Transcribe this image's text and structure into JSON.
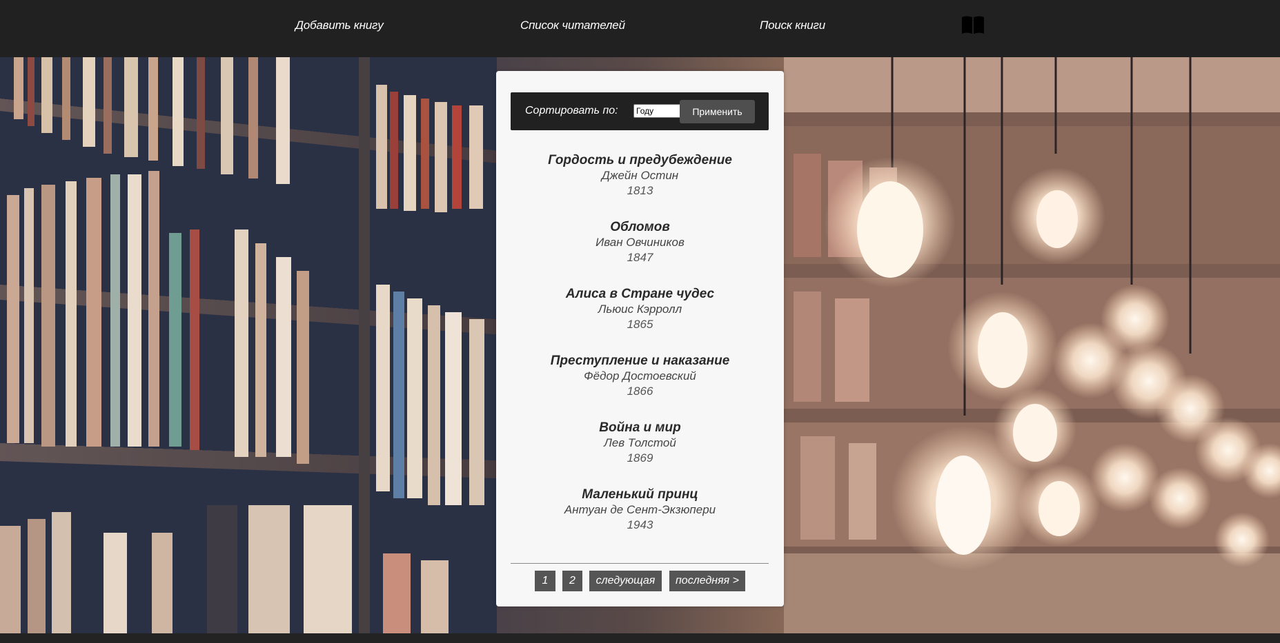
{
  "nav": {
    "add_book": "Добавить книгу",
    "readers_list": "Список читателей",
    "search_book": "Поиск книги",
    "logo_icon": "open-book-icon"
  },
  "sort": {
    "label": "Сортировать по:",
    "selected": "Году",
    "apply": "Применить"
  },
  "books": [
    {
      "title": "Гордость и предубеждение",
      "author": "Джейн Остин",
      "year": "1813"
    },
    {
      "title": "Обломов",
      "author": "Иван Овчиников",
      "year": "1847"
    },
    {
      "title": "Алиса в Стране чудес",
      "author": "Льюис Кэрролл",
      "year": "1865"
    },
    {
      "title": "Преступление и наказание",
      "author": "Фёдор Достоевский",
      "year": "1866"
    },
    {
      "title": "Война и мир",
      "author": "Лев Толстой",
      "year": "1869"
    },
    {
      "title": "Маленький принц",
      "author": "Антуан де Сент-Экзюпери",
      "year": "1943"
    }
  ],
  "pagination": {
    "page1": "1",
    "page2": "2",
    "next": "следующая",
    "last": "последняя >"
  },
  "colors": {
    "topbar": "#212121",
    "panel": "#f7f7f7",
    "button": "#555555"
  }
}
